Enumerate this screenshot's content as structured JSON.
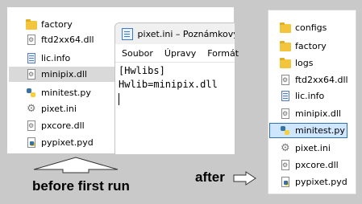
{
  "before_panel": {
    "files": [
      {
        "name": "factory",
        "icon": "folder-icon"
      },
      {
        "name": "ftd2xx64.dll",
        "icon": "dll-icon"
      },
      {
        "name": "lic.info",
        "icon": "info-file-icon"
      },
      {
        "name": "minipix.dll",
        "icon": "dll-icon",
        "highlighted": true
      },
      {
        "name": "minitest.py",
        "icon": "python-icon"
      },
      {
        "name": "pixet.ini",
        "icon": "ini-settings-icon"
      },
      {
        "name": "pxcore.dll",
        "icon": "dll-icon"
      },
      {
        "name": "pypixet.pyd",
        "icon": "pyd-icon"
      }
    ]
  },
  "notepad": {
    "title": "pixet.ini – Poznámkový",
    "menu": [
      "Soubor",
      "Úpravy",
      "Formát"
    ],
    "content_lines": [
      "[Hwlibs]",
      "Hwlib=minipix.dll"
    ]
  },
  "after_panel": {
    "files": [
      {
        "name": "configs",
        "icon": "folder-icon"
      },
      {
        "name": "factory",
        "icon": "folder-icon"
      },
      {
        "name": "logs",
        "icon": "folder-icon"
      },
      {
        "name": "ftd2xx64.dll",
        "icon": "dll-icon"
      },
      {
        "name": "lic.info",
        "icon": "info-file-icon"
      },
      {
        "name": "minipix.dll",
        "icon": "dll-icon"
      },
      {
        "name": "minitest.py",
        "icon": "python-icon",
        "selected": true
      },
      {
        "name": "pixet.ini",
        "icon": "ini-settings-icon"
      },
      {
        "name": "pxcore.dll",
        "icon": "dll-icon"
      },
      {
        "name": "pypixet.pyd",
        "icon": "pyd-icon"
      }
    ]
  },
  "captions": {
    "before": "before first run",
    "after": "after"
  },
  "colors": {
    "background": "#c9c9c9",
    "selection_fill": "#cfe6ff",
    "selection_border": "#2f6fb5",
    "folder": "#f3c53c"
  }
}
